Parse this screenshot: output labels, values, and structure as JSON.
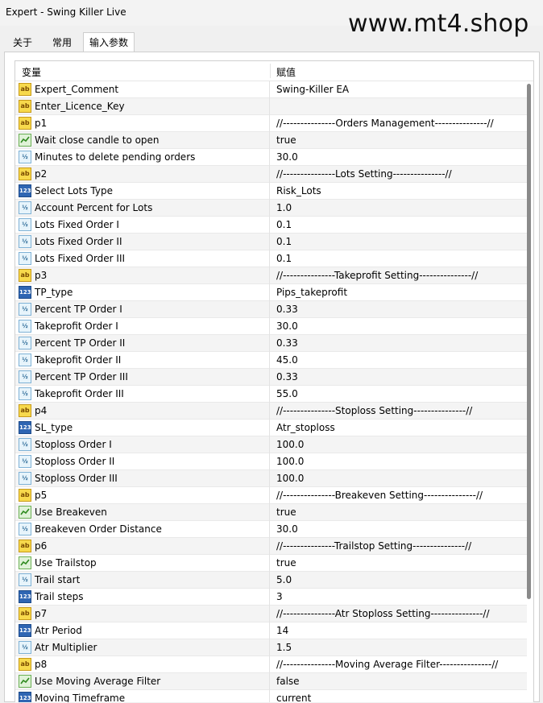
{
  "window": {
    "title": "Expert - Swing Killer Live"
  },
  "watermark": "www.mt4.shop",
  "tabs": [
    {
      "label": "关于"
    },
    {
      "label": "常用"
    },
    {
      "label": "输入参数",
      "active": true
    }
  ],
  "table": {
    "headers": {
      "variable": "变量",
      "value": "赋值"
    },
    "rows": [
      {
        "icon": "ab",
        "name": "Expert_Comment",
        "value": "Swing-Killer EA"
      },
      {
        "icon": "ab",
        "name": "Enter_Licence_Key",
        "value": ""
      },
      {
        "icon": "ab",
        "name": "p1",
        "value": "//---------------Orders Management---------------//"
      },
      {
        "icon": "bool",
        "name": "Wait close candle to open",
        "value": "true"
      },
      {
        "icon": "v12",
        "name": "Minutes to delete pending orders",
        "value": "30.0"
      },
      {
        "icon": "ab",
        "name": "p2",
        "value": "//---------------Lots Setting---------------//"
      },
      {
        "icon": "n123",
        "name": "Select Lots Type",
        "value": "Risk_Lots"
      },
      {
        "icon": "v12",
        "name": "Account Percent for Lots",
        "value": "1.0"
      },
      {
        "icon": "v12",
        "name": "Lots Fixed Order I",
        "value": "0.1"
      },
      {
        "icon": "v12",
        "name": "Lots Fixed Order II",
        "value": "0.1"
      },
      {
        "icon": "v12",
        "name": "Lots Fixed Order III",
        "value": "0.1"
      },
      {
        "icon": "ab",
        "name": "p3",
        "value": "//---------------Takeprofit Setting---------------//"
      },
      {
        "icon": "n123",
        "name": "TP_type",
        "value": "Pips_takeprofit"
      },
      {
        "icon": "v12",
        "name": "Percent TP Order I",
        "value": "0.33"
      },
      {
        "icon": "v12",
        "name": "Takeprofit Order I",
        "value": "30.0"
      },
      {
        "icon": "v12",
        "name": "Percent TP Order II",
        "value": "0.33"
      },
      {
        "icon": "v12",
        "name": "Takeprofit Order II",
        "value": "45.0"
      },
      {
        "icon": "v12",
        "name": "Percent TP Order III",
        "value": "0.33"
      },
      {
        "icon": "v12",
        "name": "Takeprofit Order III",
        "value": "55.0"
      },
      {
        "icon": "ab",
        "name": "p4",
        "value": "//---------------Stoploss Setting---------------//"
      },
      {
        "icon": "n123",
        "name": "SL_type",
        "value": "Atr_stoploss"
      },
      {
        "icon": "v12",
        "name": "Stoploss Order I",
        "value": "100.0"
      },
      {
        "icon": "v12",
        "name": "Stoploss Order II",
        "value": "100.0"
      },
      {
        "icon": "v12",
        "name": "Stoploss Order III",
        "value": "100.0"
      },
      {
        "icon": "ab",
        "name": "p5",
        "value": "//---------------Breakeven Setting---------------//"
      },
      {
        "icon": "bool",
        "name": "Use Breakeven",
        "value": "true"
      },
      {
        "icon": "v12",
        "name": "Breakeven Order Distance",
        "value": "30.0"
      },
      {
        "icon": "ab",
        "name": "p6",
        "value": "//---------------Trailstop Setting---------------//"
      },
      {
        "icon": "bool",
        "name": "Use Trailstop",
        "value": "true"
      },
      {
        "icon": "v12",
        "name": "Trail start",
        "value": "5.0"
      },
      {
        "icon": "n123",
        "name": "Trail steps",
        "value": "3"
      },
      {
        "icon": "ab",
        "name": "p7",
        "value": "//---------------Atr Stoploss Setting---------------//"
      },
      {
        "icon": "n123",
        "name": "Atr Period",
        "value": "14"
      },
      {
        "icon": "v12",
        "name": "Atr Multiplier",
        "value": "1.5"
      },
      {
        "icon": "ab",
        "name": "p8",
        "value": "//---------------Moving Average Filter---------------//"
      },
      {
        "icon": "bool",
        "name": "Use Moving Average Filter",
        "value": "false"
      },
      {
        "icon": "n123",
        "name": "Moving Timeframe",
        "value": "current"
      }
    ]
  },
  "icon_types": {
    "ab": "string-type-icon",
    "v12": "double-type-icon",
    "n123": "integer-type-icon",
    "bool": "bool-type-icon"
  }
}
